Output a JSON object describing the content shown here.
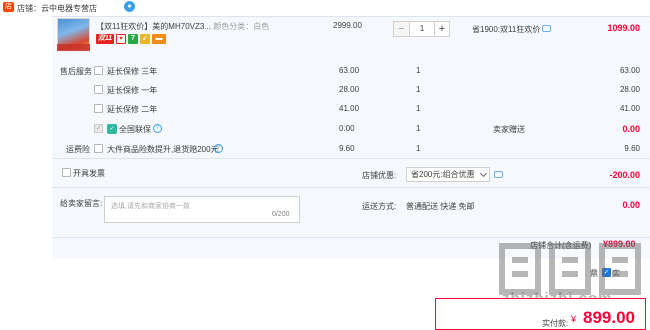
{
  "shop": {
    "tag": "店",
    "label": "店铺：云中电器专营店",
    "ww_icon": "wangwang-icon"
  },
  "item": {
    "title": "【双11狂欢价】美的MH70VZ3...",
    "sku": "颜色分类：白色",
    "badges": [
      "双11",
      "♥",
      "7",
      "➹",
      "▬"
    ],
    "price": "2999.00",
    "quantity": "1",
    "minus": "−",
    "plus": "+",
    "promo": "省1900:双11狂欢价",
    "subtotal": "1099.00"
  },
  "services": {
    "label": "售后服务",
    "options": [
      {
        "label": "延长保修 三年",
        "price": "63.00",
        "qty": "1",
        "total": "63.00",
        "checked": false
      },
      {
        "label": "延长保修 一年",
        "price": "28.00",
        "qty": "1",
        "total": "28.00",
        "checked": false
      },
      {
        "label": "延长保修 二年",
        "price": "41.00",
        "qty": "1",
        "total": "41.00",
        "checked": false
      },
      {
        "label": "全国联保",
        "price": "0.00",
        "qty": "1",
        "note": "卖家赠送",
        "total": "0.00",
        "checked": true
      }
    ]
  },
  "insurance": {
    "label": "运费险",
    "option": "大件商品险数提升,退货赔200元",
    "price": "9.60",
    "qty": "1",
    "total": "9.60"
  },
  "invoice": {
    "label": "开具发票"
  },
  "discount": {
    "label": "店铺优惠:",
    "selected": "省200元:组合优惠",
    "amount": "-200.00"
  },
  "message": {
    "label": "给卖家留言:",
    "placeholder": "选填,请先和商家协商一致",
    "count": "0/200"
  },
  "delivery": {
    "label": "运送方式:",
    "value": "普通配送 快递 免邮",
    "amount": "0.00"
  },
  "total": {
    "label": "店铺合计(含运费)",
    "value": "¥899.00"
  },
  "agree": {
    "prefix": "鼎",
    "text": "实"
  },
  "pay": {
    "label": "实付款:",
    "currency": "¥",
    "amount": "899.00"
  },
  "watermark": {
    "text": "zhizhizhi.com"
  },
  "colors": {
    "accent_red": "#ff0036",
    "brand_orange": "#ff4400",
    "link_blue": "#3aa0e8",
    "row_bg": "#f5f8fd"
  }
}
